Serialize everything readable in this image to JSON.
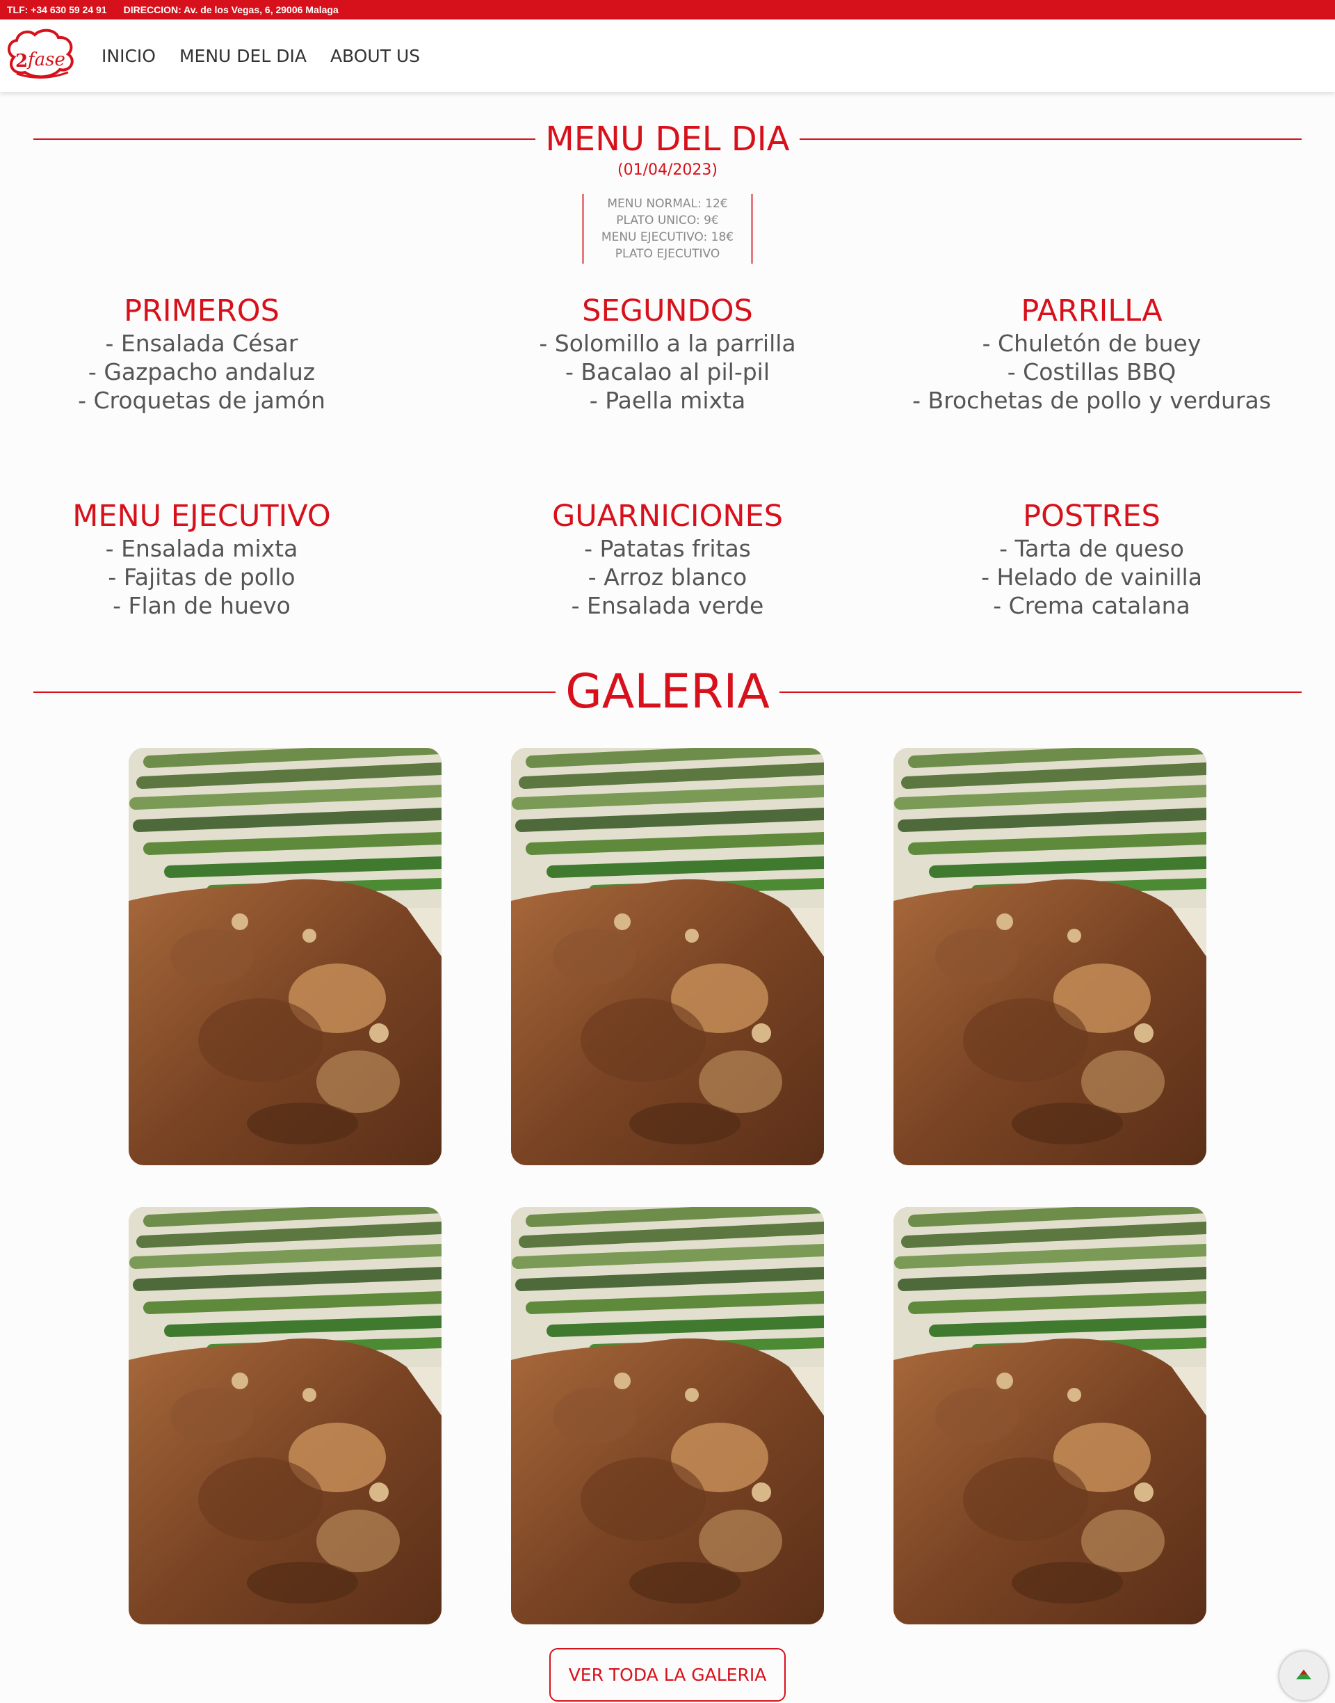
{
  "topbar": {
    "phone": "TLF: +34 630 59 24 91",
    "address": "DIRECCION: Av. de los Vegas, 6, 29006 Malaga"
  },
  "logo": {
    "text": "fase",
    "digit": "2"
  },
  "nav": {
    "items": [
      {
        "label": "INICIO"
      },
      {
        "label": "MENU DEL DIA"
      },
      {
        "label": "ABOUT US"
      }
    ]
  },
  "menu": {
    "title": "MENU DEL DIA",
    "date": "(01/04/2023)",
    "prices": [
      "MENU NORMAL: 12€",
      "PLATO UNICO: 9€",
      "MENU EJECUTIVO: 18€",
      "PLATO EJECUTIVO"
    ],
    "sections": [
      {
        "title": "PRIMEROS",
        "items": [
          "- Ensalada César",
          "- Gazpacho andaluz",
          "- Croquetas de jamón"
        ]
      },
      {
        "title": "SEGUNDOS",
        "items": [
          "- Solomillo a la parrilla",
          "- Bacalao al pil-pil",
          "- Paella mixta"
        ]
      },
      {
        "title": "PARRILLA",
        "items": [
          "- Chuletón de buey",
          "- Costillas BBQ",
          "- Brochetas de pollo y verduras"
        ]
      },
      {
        "title": "MENU EJECUTIVO",
        "items": [
          "- Ensalada mixta",
          "- Fajitas de pollo",
          "- Flan de huevo"
        ]
      },
      {
        "title": "GUARNICIONES",
        "items": [
          "- Patatas fritas",
          "- Arroz blanco",
          "- Ensalada verde"
        ]
      },
      {
        "title": "POSTRES",
        "items": [
          "- Tarta de queso",
          "- Helado de vainilla",
          "- Crema catalana"
        ]
      }
    ]
  },
  "gallery": {
    "title": "GALERIA",
    "button_label": "VER TODA LA GALERIA",
    "photo_count": 6
  },
  "colors": {
    "accent": "#d7111b",
    "text": "#555555"
  }
}
